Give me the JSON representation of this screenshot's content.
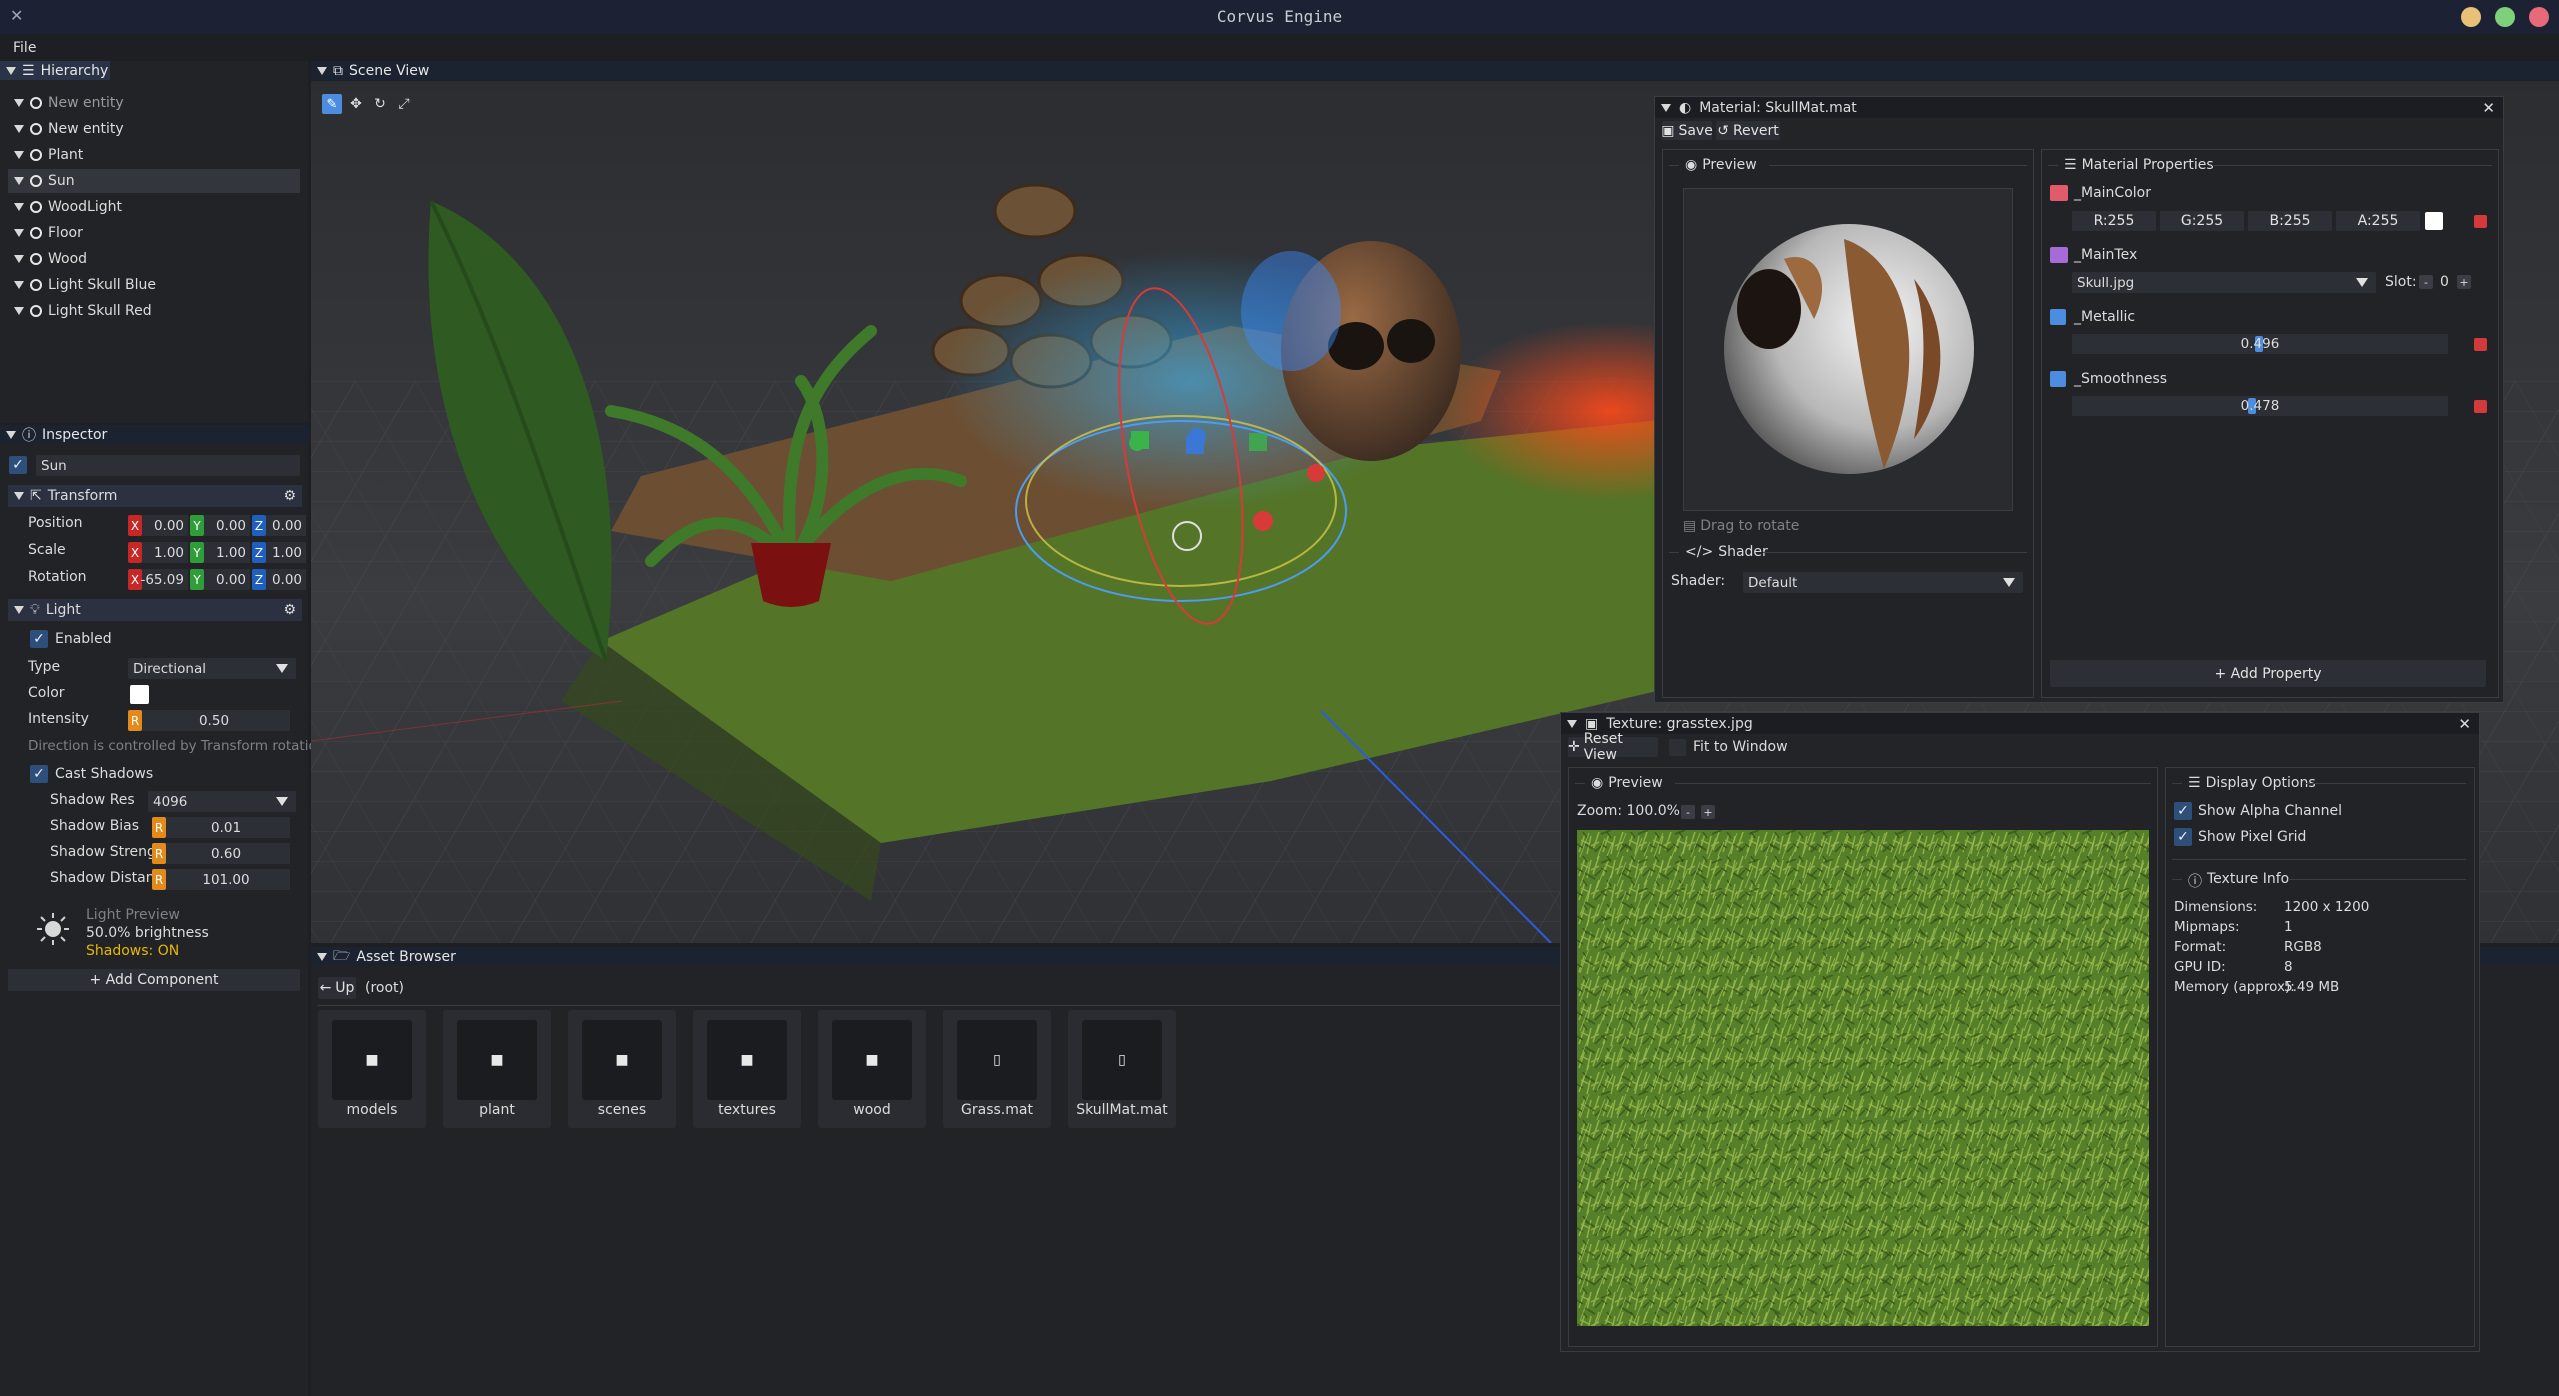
{
  "app": {
    "title": "Corvus Engine"
  },
  "menu": {
    "file": "File"
  },
  "hierarchy": {
    "title": "Hierarchy",
    "items": [
      "New entity",
      "New entity",
      "Plant",
      "Sun",
      "WoodLight",
      "Floor",
      "Wood",
      "Light Skull Blue",
      "Light Skull Red"
    ]
  },
  "inspector": {
    "title": "Inspector",
    "entity_name": "Sun",
    "transform": {
      "title": "Transform",
      "position_label": "Position",
      "position": [
        "0.00",
        "0.00",
        "0.00"
      ],
      "scale_label": "Scale",
      "scale": [
        "1.00",
        "1.00",
        "1.00"
      ],
      "rotation_label": "Rotation",
      "rotation": [
        "-65.09",
        "0.00",
        "0.00"
      ]
    },
    "light": {
      "title": "Light",
      "enabled_label": "Enabled",
      "type_label": "Type",
      "type_value": "Directional",
      "color_label": "Color",
      "intensity_label": "Intensity",
      "intensity": "0.50",
      "direction_note": "Direction is controlled by Transform rotation",
      "cast_shadows_label": "Cast Shadows",
      "shadow_res_label": "Shadow Res",
      "shadow_res": "4096",
      "shadow_bias_label": "Shadow Bias",
      "shadow_bias": "0.01",
      "shadow_strength_label": "Shadow Streng",
      "shadow_strength": "0.60",
      "shadow_distance_label": "Shadow Distan",
      "shadow_distance": "101.00",
      "preview_title": "Light Preview",
      "preview_brightness": "50.0% brightness",
      "preview_shadows": "Shadows: ON"
    },
    "add_component": "+ Add Component"
  },
  "scene": {
    "title": "Scene View"
  },
  "asset_browser": {
    "title": "Asset Browser",
    "up": "Up",
    "path": "(root)",
    "items": [
      "models",
      "plant",
      "scenes",
      "textures",
      "wood",
      "Grass.mat",
      "SkullMat.mat"
    ]
  },
  "material": {
    "title": "Material: SkullMat.mat",
    "save": "Save",
    "revert": "Revert",
    "preview_title": "Preview",
    "drag_hint": "Drag to rotate",
    "shader_title": "Shader",
    "shader_label": "Shader:",
    "shader_value": "Default",
    "props_title": "Material Properties",
    "main_color": "_MainColor",
    "r": "R:255",
    "g": "G:255",
    "b": "B:255",
    "a": "A:255",
    "main_tex": "_MainTex",
    "main_tex_value": "Skull.jpg",
    "slot_label": "Slot:",
    "slot_value": "0",
    "metallic": "_Metallic",
    "metallic_value": "0.496",
    "metallic_fraction": 0.496,
    "smoothness": "_Smoothness",
    "smoothness_value": "0.478",
    "smoothness_fraction": 0.478,
    "add_property": "+ Add Property"
  },
  "texture": {
    "title": "Texture: grasstex.jpg",
    "reset_view": "Reset View",
    "fit_window": "Fit to Window",
    "preview_title": "Preview",
    "zoom_label": "Zoom: 100.0%",
    "display_options": "Display Options",
    "show_alpha": "Show Alpha Channel",
    "show_grid": "Show Pixel Grid",
    "info_title": "Texture Info",
    "info": [
      {
        "k": "Dimensions:",
        "v": "1200 x 1200"
      },
      {
        "k": "Mipmaps:",
        "v": "1"
      },
      {
        "k": "Format:",
        "v": "RGB8"
      },
      {
        "k": "GPU ID:",
        "v": "8"
      },
      {
        "k": "Memory (approx):",
        "v": "5.49 MB"
      }
    ]
  },
  "colors": {
    "accent": "#4d8de0",
    "axis_x": "#c62828",
    "axis_y": "#2e9d3a",
    "axis_z": "#1f5fbf",
    "orange": "#e38a1a",
    "warning": "#e6b800"
  }
}
